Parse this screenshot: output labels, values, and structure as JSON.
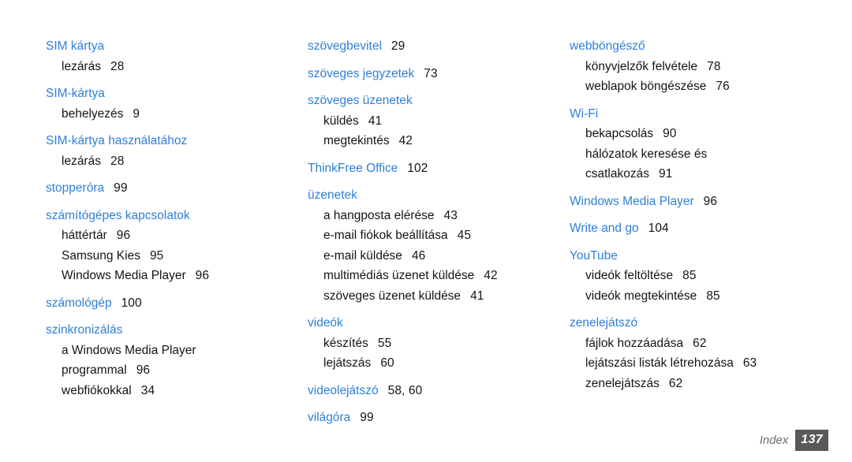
{
  "page": {
    "background_color": "#ffffff",
    "heading_color": "#2f7fd6",
    "text_color": "#141414"
  },
  "footer": {
    "label": "Index",
    "page_number": "137",
    "badge_color": "#595959",
    "label_color": "#6e6e6e"
  },
  "columns": [
    {
      "groups": [
        {
          "heading": {
            "label": "SIM kártya",
            "pages": ""
          },
          "entries": [
            {
              "label": "lezárás",
              "pages": "28"
            }
          ]
        },
        {
          "heading": {
            "label": "SIM-kártya",
            "pages": ""
          },
          "entries": [
            {
              "label": "behelyezés",
              "pages": "9"
            }
          ]
        },
        {
          "heading": {
            "label": "SIM-kártya használatához",
            "pages": ""
          },
          "entries": [
            {
              "label": "lezárás",
              "pages": "28"
            }
          ]
        },
        {
          "heading": {
            "label": "stopperóra",
            "pages": "99"
          },
          "entries": []
        },
        {
          "heading": {
            "label": "számítógépes kapcsolatok",
            "pages": ""
          },
          "entries": [
            {
              "label": "háttértár",
              "pages": "96"
            },
            {
              "label": "Samsung Kies",
              "pages": "95"
            },
            {
              "label": "Windows Media Player",
              "pages": "96"
            }
          ]
        },
        {
          "heading": {
            "label": "számológép",
            "pages": "100"
          },
          "entries": []
        },
        {
          "heading": {
            "label": "szinkronizálás",
            "pages": ""
          },
          "entries": [
            {
              "label": "a Windows Media Player",
              "pages": ""
            },
            {
              "label": "programmal",
              "pages": "96",
              "continuation": true
            },
            {
              "label": "webfiókokkal",
              "pages": "34"
            }
          ]
        }
      ]
    },
    {
      "groups": [
        {
          "heading": {
            "label": "szövegbevitel",
            "pages": "29"
          },
          "entries": []
        },
        {
          "heading": {
            "label": "szöveges jegyzetek",
            "pages": "73"
          },
          "entries": []
        },
        {
          "heading": {
            "label": "szöveges üzenetek",
            "pages": ""
          },
          "entries": [
            {
              "label": "küldés",
              "pages": "41"
            },
            {
              "label": "megtekintés",
              "pages": "42"
            }
          ]
        },
        {
          "heading": {
            "label": "ThinkFree Office",
            "pages": "102"
          },
          "entries": []
        },
        {
          "heading": {
            "label": "üzenetek",
            "pages": ""
          },
          "entries": [
            {
              "label": "a hangposta elérése",
              "pages": "43"
            },
            {
              "label": "e-mail fiókok beállítása",
              "pages": "45"
            },
            {
              "label": "e-mail küldése",
              "pages": "46"
            },
            {
              "label": "multimédiás üzenet küldése",
              "pages": "42"
            },
            {
              "label": "szöveges üzenet küldése",
              "pages": "41"
            }
          ]
        },
        {
          "heading": {
            "label": "videók",
            "pages": ""
          },
          "entries": [
            {
              "label": "készítés",
              "pages": "55"
            },
            {
              "label": "lejátszás",
              "pages": "60"
            }
          ]
        },
        {
          "heading": {
            "label": "videolejátszó",
            "pages": "58, 60"
          },
          "entries": []
        },
        {
          "heading": {
            "label": "világóra",
            "pages": "99"
          },
          "entries": []
        }
      ]
    },
    {
      "groups": [
        {
          "heading": {
            "label": "webböngésző",
            "pages": ""
          },
          "entries": [
            {
              "label": "könyvjelzők felvétele",
              "pages": "78"
            },
            {
              "label": "weblapok böngészése",
              "pages": "76"
            }
          ]
        },
        {
          "heading": {
            "label": "Wi-Fi",
            "pages": ""
          },
          "entries": [
            {
              "label": "bekapcsolás",
              "pages": "90"
            },
            {
              "label": "hálózatok keresése és",
              "pages": ""
            },
            {
              "label": "csatlakozás",
              "pages": "91",
              "continuation": true
            }
          ]
        },
        {
          "heading": {
            "label": "Windows Media Player",
            "pages": "96"
          },
          "entries": []
        },
        {
          "heading": {
            "label": "Write and go",
            "pages": "104"
          },
          "entries": []
        },
        {
          "heading": {
            "label": "YouTube",
            "pages": ""
          },
          "entries": [
            {
              "label": "videók feltöltése",
              "pages": "85"
            },
            {
              "label": "videók megtekintése",
              "pages": "85"
            }
          ]
        },
        {
          "heading": {
            "label": "zenelejátszó",
            "pages": ""
          },
          "entries": [
            {
              "label": "fájlok hozzáadása",
              "pages": "62"
            },
            {
              "label": "lejátszási listák létrehozása",
              "pages": "63"
            },
            {
              "label": "zenelejátszás",
              "pages": "62"
            }
          ]
        }
      ]
    }
  ]
}
